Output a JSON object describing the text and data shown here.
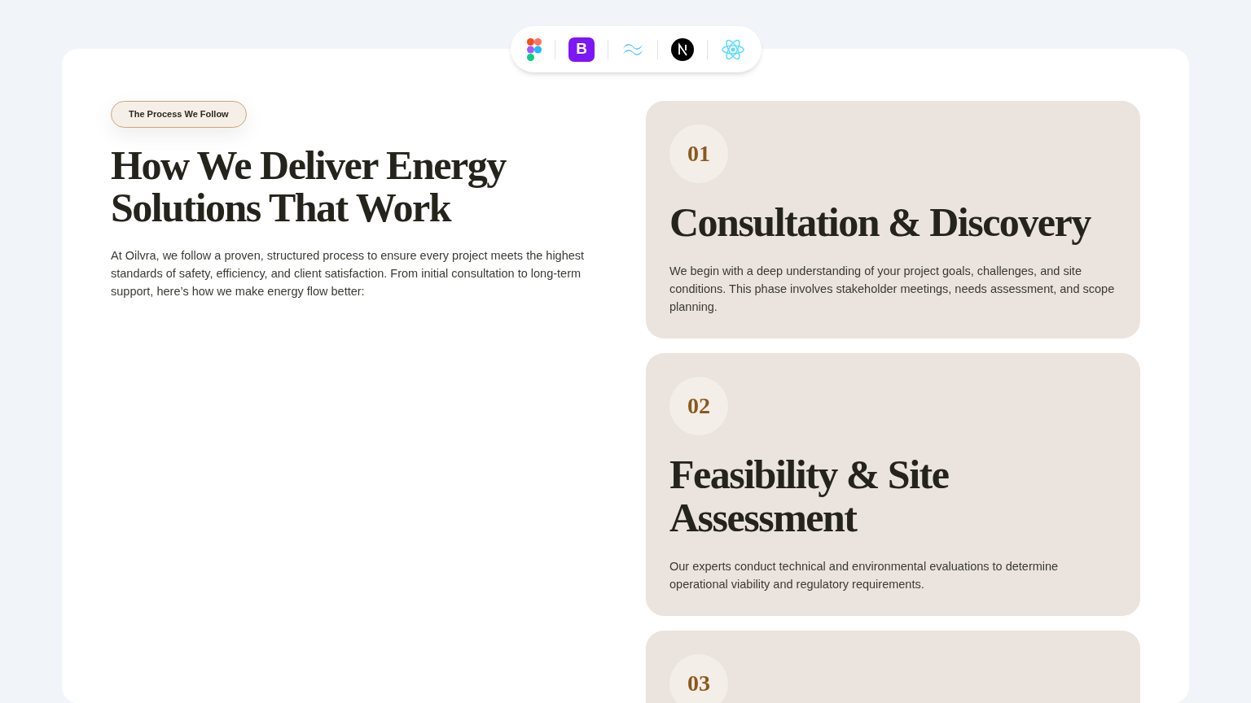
{
  "toolbar": [
    {
      "kind": "figma"
    },
    {
      "kind": "bootstrap",
      "glyph": "B"
    },
    {
      "kind": "tailwind"
    },
    {
      "kind": "next"
    },
    {
      "kind": "react"
    }
  ],
  "intro": {
    "badge": "The Process We Follow",
    "heading": "How We Deliver Energy Solutions That Work",
    "text": "At Oilvra, we follow a proven, structured process to ensure every project meets the highest standards of safety, efficiency, and client satisfaction. From initial consultation to long-term support, here’s how we make energy flow better:"
  },
  "steps": [
    {
      "number": "01",
      "title": "Consultation & Discovery",
      "text": "We begin with a deep understanding of your project goals, challenges, and site conditions. This phase involves stakeholder meetings, needs assessment, and scope planning."
    },
    {
      "number": "02",
      "title": "Feasibility & Site Assessment",
      "text": "Our experts conduct technical and environmental evaluations to determine operational viability and regulatory requirements."
    },
    {
      "number": "03"
    }
  ]
}
